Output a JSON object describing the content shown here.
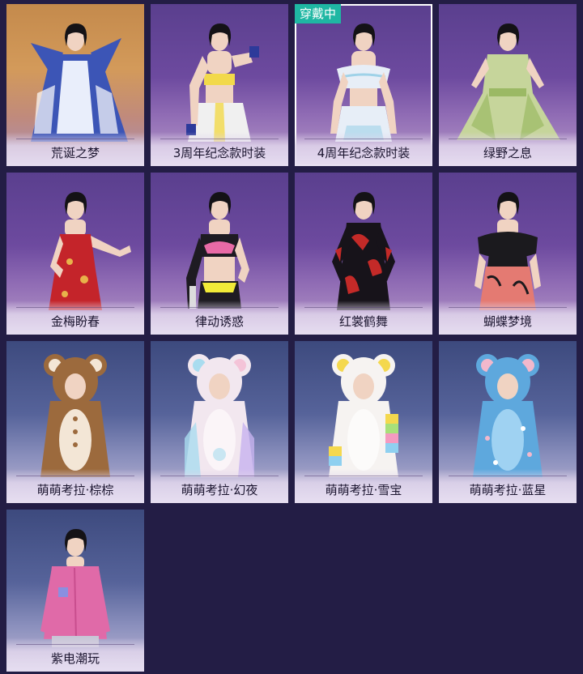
{
  "badge": {
    "equipped_label": "穿戴中"
  },
  "outfits": [
    {
      "name": "荒诞之梦",
      "colors": {
        "main": "#3c55b6",
        "accent": "#ffffff"
      }
    },
    {
      "name": "3周年纪念款时装",
      "colors": {
        "main": "#f0f0f0",
        "accent": "#f2d94a"
      }
    },
    {
      "name": "4周年纪念款时装",
      "colors": {
        "main": "#e7eef7",
        "accent": "#9fd2e8"
      }
    },
    {
      "name": "绿野之息",
      "colors": {
        "main": "#c6d59b",
        "accent": "#9bb964"
      }
    },
    {
      "name": "金梅盼春",
      "colors": {
        "main": "#c4242a",
        "accent": "#e8b24a"
      }
    },
    {
      "name": "律动诱惑",
      "colors": {
        "main": "#1e1b22",
        "accent": "#f1ea38"
      }
    },
    {
      "name": "红裳鹤舞",
      "colors": {
        "main": "#17131a",
        "accent": "#c42a28"
      }
    },
    {
      "name": "蝴蝶梦境",
      "colors": {
        "main": "#1b1a1e",
        "accent": "#e47a72"
      }
    },
    {
      "name": "萌萌考拉·棕棕",
      "colors": {
        "main": "#9c6a3d",
        "accent": "#f3e6d6"
      }
    },
    {
      "name": "萌萌考拉·幻夜",
      "colors": {
        "main": "#f2e7ef",
        "accent": "#a9dcef"
      }
    },
    {
      "name": "萌萌考拉·雪宝",
      "colors": {
        "main": "#f6f3f1",
        "accent": "#f4d84e"
      }
    },
    {
      "name": "萌萌考拉·蓝星",
      "colors": {
        "main": "#5ea8dd",
        "accent": "#f2b8cc"
      }
    },
    {
      "name": "紫电潮玩",
      "colors": {
        "main": "#e06aa8",
        "accent": "#c8c6d6"
      }
    }
  ]
}
